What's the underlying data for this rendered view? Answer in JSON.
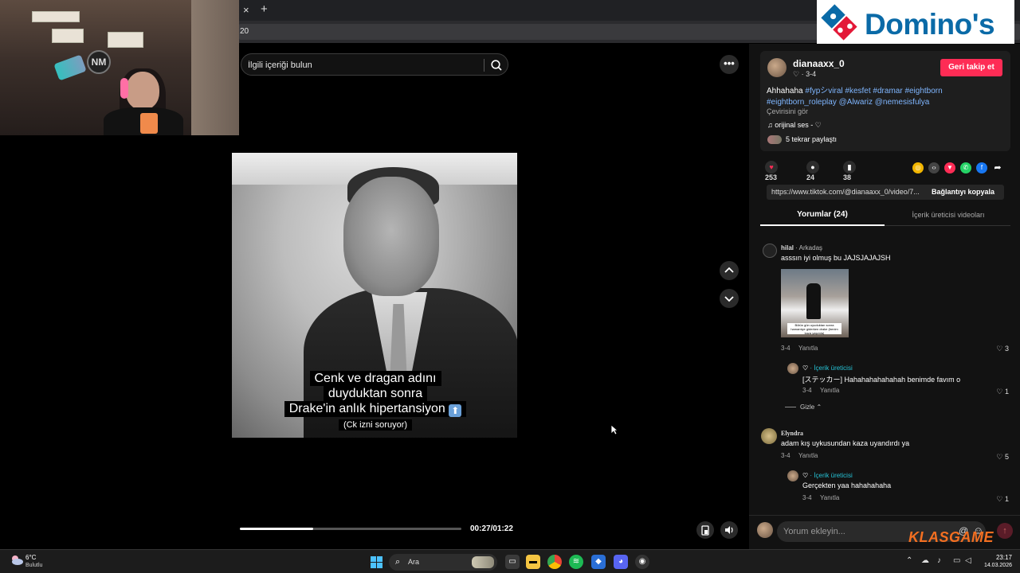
{
  "browser": {
    "tab_close": "×",
    "tab_new": "+",
    "address_text": "20"
  },
  "webcam": {
    "logo_text": "NM"
  },
  "ad": {
    "brand": "Domino's",
    "brand_color": "#0a6aa7"
  },
  "video": {
    "search_placeholder": "İlgili içeriği bulun",
    "more_button": "•••",
    "caption_lines": [
      "Cenk ve dragan adını",
      "duyduktan sonra",
      "Drake'in anlık hipertansiyon"
    ],
    "caption_sub": "(Ck izni soruyor)",
    "caption_emoji": "⬆",
    "time": "00:27/01:22",
    "progress_fraction": 0.33
  },
  "panel": {
    "author": {
      "name": "dianaaxx_0",
      "sub": "♡ · 3-4",
      "follow_label": "Geri takip et"
    },
    "description": {
      "text_prefix": "Ahhahaha ",
      "tags": "#fypシviral #kesfet #dramar #eightborn #eightborn_roleplay @Alwariz @nemesisfulya"
    },
    "translate_label": "Çevirisini gör",
    "sound": "♫  orijinal ses - ♡",
    "reposts": "5 tekrar paylaştı",
    "stats": {
      "likes": "253",
      "comments": "24",
      "saves": "38"
    },
    "share_icons": [
      "coin-icon",
      "embed-icon",
      "send-icon",
      "whatsapp-icon",
      "facebook-icon",
      "share-arrow-icon"
    ],
    "link": {
      "url": "https://www.tiktok.com/@dianaaxx_0/video/7...",
      "copy_label": "Bağlantıyı kopyala"
    },
    "tabs": {
      "comments": "Yorumlar (24)",
      "creator_videos": "İçerik üreticisi videoları"
    },
    "comments": [
      {
        "user": "hilal",
        "relation": " · Arkadaş",
        "text": "asssın iyi olmuş bu JAJSJAJAJSH",
        "date": "3-4",
        "reply": "Yanıtla",
        "likes": "♡ 3",
        "thumb_caption": "Bütün gün uyuduktan sonra hamamiye giderken drake (benim kaza yaşımla)"
      },
      {
        "user": "♡",
        "relation": " · İçerik üreticisi",
        "text": "[ステッカー] Hahahahahahahah benimde favım o",
        "date": "3-4",
        "reply": "Yanıtla",
        "likes": "♡ 1"
      },
      {
        "hide_label": "Gizle ⌃"
      },
      {
        "user": "Elyndra",
        "relation": "",
        "text": "adam kış uykusundan kaza uyandırdı ya",
        "date": "3-4",
        "reply": "Yanıtla",
        "likes": "♡ 5"
      },
      {
        "user": "♡",
        "relation": " · İçerik üreticisi",
        "text": "Gerçekten yaa hahahahaha",
        "date": "3-4",
        "reply": "Yanıtla",
        "likes": "♡ 1"
      }
    ],
    "comment_placeholder": "Yorum ekleyin...",
    "comment_icons": [
      "@",
      "☺"
    ]
  },
  "watermark": "KLASGAME",
  "taskbar": {
    "temp": "6°C",
    "condition": "Bulutlu",
    "search_label": "Ara",
    "time": "23:17",
    "date": "14.03.2026"
  },
  "colors": {
    "follow_red": "#fe2c55",
    "tag_blue": "#7fb6ff",
    "creator_cyan": "#25c2d5",
    "watermark_orange": "#f36f21"
  }
}
